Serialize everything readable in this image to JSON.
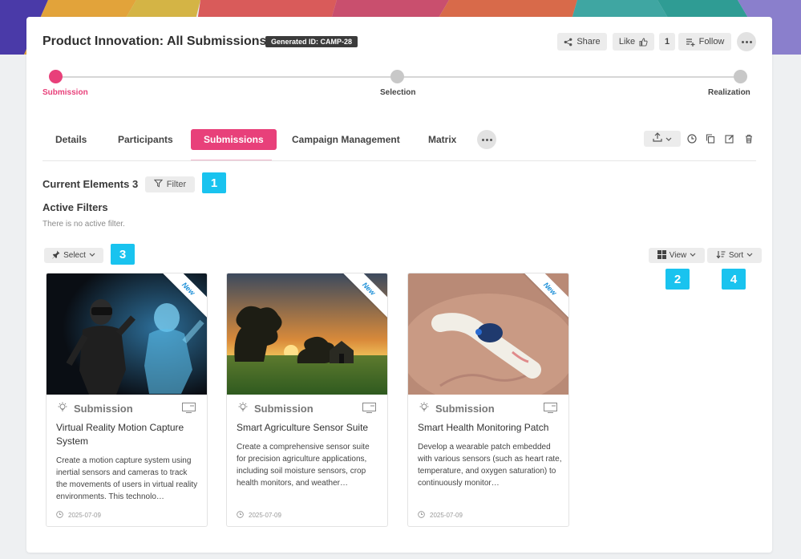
{
  "header": {
    "title": "Product Innovation: All Submissions",
    "id_badge": "Generated ID: CAMP-28",
    "share_label": "Share",
    "like_label": "Like",
    "like_count": "1",
    "follow_label": "Follow"
  },
  "progress": {
    "steps": [
      {
        "label": "Submission",
        "active": true
      },
      {
        "label": "Selection",
        "active": false
      },
      {
        "label": "Realization",
        "active": false
      }
    ]
  },
  "tabs": [
    {
      "label": "Details"
    },
    {
      "label": "Participants"
    },
    {
      "label": "Submissions",
      "active": true
    },
    {
      "label": "Campaign Management"
    },
    {
      "label": "Matrix"
    }
  ],
  "toolbar": {
    "current_elements": "Current Elements 3",
    "filter_label": "Filter",
    "active_filters_title": "Active Filters",
    "no_filter_text": "There is no active filter.",
    "select_label": "Select",
    "view_label": "View",
    "sort_label": "Sort"
  },
  "markers": [
    "1",
    "2",
    "3",
    "4"
  ],
  "cards": [
    {
      "badge": "New",
      "type": "Submission",
      "title": "Virtual Reality Motion Capture System",
      "description": "Create a motion capture system using inertial sensors and cameras to track the movements of users in virtual reality environments. This technolo…",
      "date": "2025-07-09"
    },
    {
      "badge": "New",
      "type": "Submission",
      "title": "Smart Agriculture Sensor Suite",
      "description": "Create a comprehensive sensor suite for precision agriculture applications, including soil moisture sensors, crop health monitors, and weather…",
      "date": "2025-07-09"
    },
    {
      "badge": "New",
      "type": "Submission",
      "title": "Smart Health Monitoring Patch",
      "description": "Develop a wearable patch embedded with various sensors (such as heart rate, temperature, and oxygen saturation) to continuously monitor…",
      "date": "2025-07-09"
    }
  ],
  "colors": {
    "accent": "#e8407a",
    "marker": "#19c3ef",
    "badge_text": "#1e90d8"
  }
}
